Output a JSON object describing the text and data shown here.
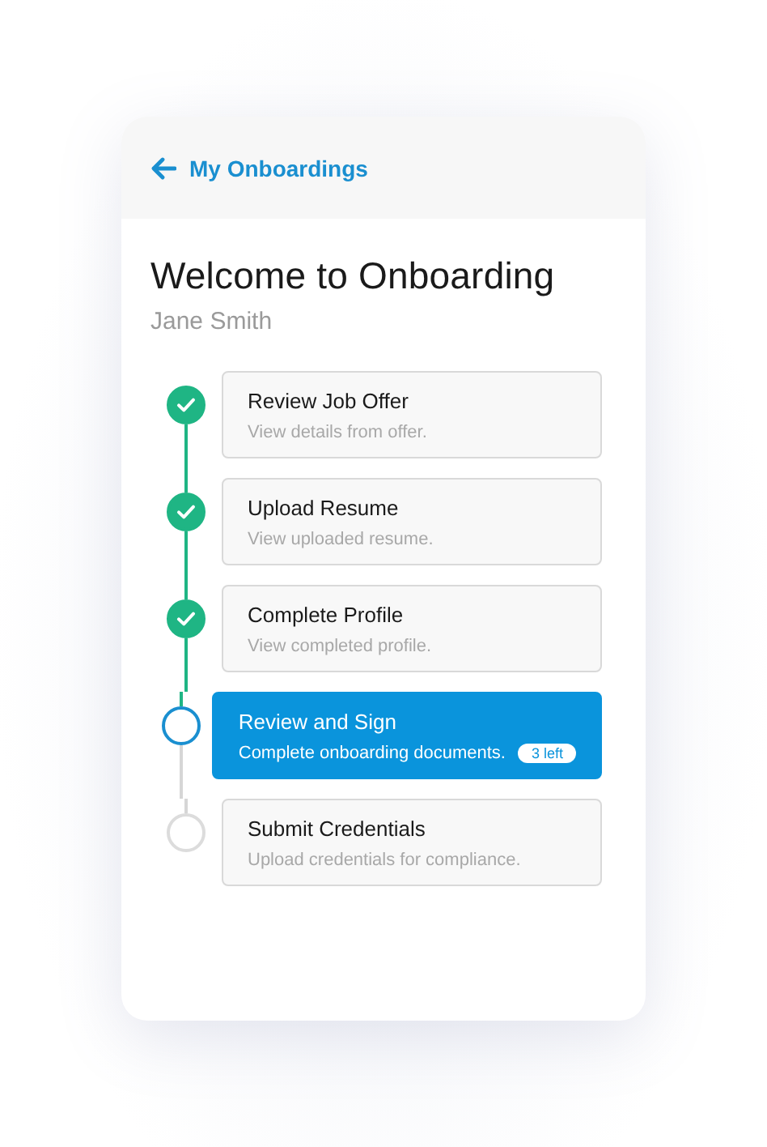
{
  "header": {
    "back_label": "My Onboardings"
  },
  "title": "Welcome to Onboarding",
  "subtitle": "Jane Smith",
  "steps": [
    {
      "title": "Review Job Offer",
      "description": "View details from offer.",
      "kind": "done",
      "selected": false
    },
    {
      "title": "Upload Resume",
      "description": "View uploaded resume.",
      "kind": "done",
      "selected": false
    },
    {
      "title": "Complete Profile",
      "description": "View completed profile.",
      "kind": "done",
      "selected": false
    },
    {
      "title": "Review and Sign",
      "description": "Complete onboarding documents.",
      "badge": "3 left",
      "kind": "current",
      "selected": true
    },
    {
      "title": "Submit Credentials",
      "description": "Upload credentials for compliance.",
      "kind": "pending",
      "selected": false
    }
  ]
}
